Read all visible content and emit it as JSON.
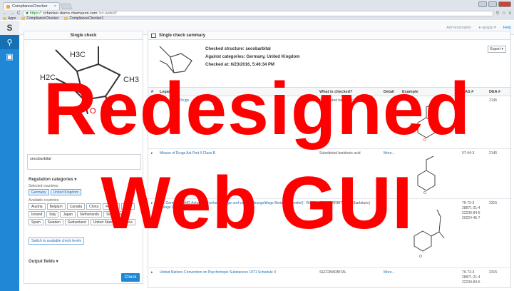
{
  "browser": {
    "tab_title": "ComplianceChecker",
    "tab_close": "×",
    "url_https": "https://",
    "url_host": "cchecker-demo.chemaxon.com",
    "url_path": "/cc-web/#/",
    "bookmarks": [
      "Apps",
      "ComplianceChecker",
      "ComplianceChecker1"
    ]
  },
  "topbar": {
    "admin": "Administration",
    "user": "apapp",
    "help": "Help"
  },
  "left": {
    "title": "Single check",
    "compound_name": "secobarbital",
    "structure_labels": {
      "a": "H3C",
      "b": "H2C",
      "c": "CH3",
      "d": "O"
    },
    "reg_title": "Regulation categories",
    "selected_label": "Selected countries:",
    "selected": [
      "Germany",
      "United Kingdom"
    ],
    "available_label": "Available countries:",
    "available": [
      "Austria",
      "Belgium",
      "Canada",
      "China",
      "France",
      "India",
      "Ireland",
      "Italy",
      "Japan",
      "Netherlands",
      "Singapore",
      "Spain",
      "Sweden",
      "Switzerland",
      "United States of America"
    ],
    "switch_label": "Switch to available check levels",
    "output_title": "Output fields",
    "check_label": "Check"
  },
  "summary": {
    "title": "Single check summary",
    "checked_structure": "Checked structure: secobarbital",
    "against": "Against categories: Germany, United Kingdom",
    "checked_at": "Checked at: 6/23/2016, 5:46:34 PM",
    "export_label": "Export",
    "headers": {
      "legal": "Legal",
      "what": "What is checked?",
      "detail": "Detail",
      "example": "Example",
      "cas": "CAS #",
      "dea": "DEA #"
    },
    "rows": [
      {
        "law": "Schedule of Drugs ... Schedule II",
        "what": "Substituted barbituric acid",
        "more": "More...",
        "cas": "",
        "dea": "2145"
      },
      {
        "law": "Misuse of Drugs Act Part II Class B",
        "what": "Substituted barbituric acid",
        "more": "More...",
        "cas": "57-44-3",
        "dea": "2145"
      },
      {
        "law": "DE Germany BtMG Anlage III (verkehrsfähige und verschreibungsfähige Betäubungsmittel) - BtMG Anlage III",
        "what": "SECOBARBITAL 2-yl(barbituric)",
        "more": "",
        "cas": "76-73-3 28871-21-4 22239-84-5 20224-45-7",
        "dea": "2315"
      },
      {
        "law": "United Nations Convention on Psychotropic Substances 1971 Schedule II",
        "what": "SECOBARBITAL",
        "more": "More...",
        "cas": "76-73-3 28871-21-4 22239-84-5",
        "dea": "2315"
      }
    ]
  },
  "overlay": {
    "line1": "Redesigned",
    "line2": "Web GUI"
  },
  "colors": {
    "accent": "#1e88d6",
    "overlay": "#ff0000"
  }
}
